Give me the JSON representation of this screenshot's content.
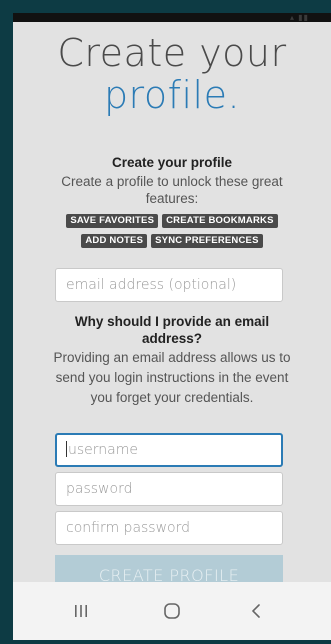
{
  "header": {
    "line1": "Create your",
    "line2": "profile."
  },
  "intro": {
    "title": "Create your profile",
    "description": "Create a profile to unlock these great features:"
  },
  "features": [
    "SAVE FAVORITES",
    "CREATE BOOKMARKS",
    "ADD NOTES",
    "SYNC PREFERENCES"
  ],
  "email": {
    "placeholder": "email address (optional)"
  },
  "why": {
    "title": "Why should I provide an email address?",
    "description": "Providing an email address allows us to send you login instructions in the event you forget your credentials."
  },
  "form": {
    "username_placeholder": "username",
    "password_placeholder": "password",
    "confirm_placeholder": "confirm password",
    "submit_label": "CREATE PROFILE"
  },
  "navbar": {
    "recents": "recents-icon",
    "home": "home-icon",
    "back": "back-icon"
  },
  "colors": {
    "accent": "#2b7bb5",
    "button_disabled": "#b3ccd6",
    "tag_bg": "#4a4a4a"
  }
}
